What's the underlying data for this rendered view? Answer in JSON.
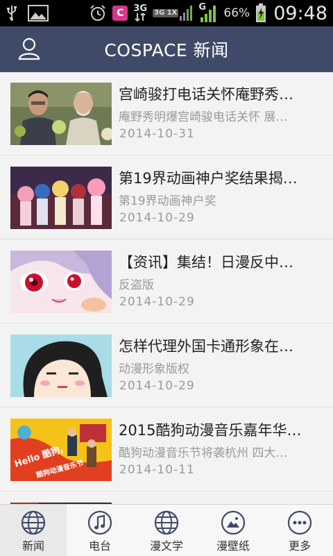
{
  "status_bar": {
    "network": "3G",
    "network_secondary": "3G 1X",
    "signal_label": "G",
    "battery": "66%",
    "time": "09:48",
    "badge_letter": "C"
  },
  "header": {
    "title": "COSPACE 新闻"
  },
  "news": [
    {
      "title": "宫崎骏打电话关怀庵野秀…",
      "summary": "庵野秀明爆宫崎骏电话关怀 展…",
      "date": "2014-10-31"
    },
    {
      "title": "第19界动画神户奖结果揭…",
      "summary": "第19界动画神户奖",
      "date": "2014-10-29"
    },
    {
      "title": "【资讯】集结！日漫反中…",
      "summary": "反盗版",
      "date": "2014-10-29"
    },
    {
      "title": "怎样代理外国卡通形象在…",
      "summary": "动漫形象版权",
      "date": "2014-10-29"
    },
    {
      "title": "2015酷狗动漫音乐嘉年华…",
      "summary": "酷狗动漫音乐节将袭杭州 四大…",
      "date": "2014-10-11"
    }
  ],
  "thumb5_text": {
    "hello": "Hello 酷狗,",
    "festival": "酷狗动漫音乐节"
  },
  "nav": [
    {
      "label": "新闻",
      "icon": "globe-icon"
    },
    {
      "label": "电台",
      "icon": "music-note-icon"
    },
    {
      "label": "漫文学",
      "icon": "globe-icon"
    },
    {
      "label": "漫壁纸",
      "icon": "image-icon"
    },
    {
      "label": "更多",
      "icon": "more-icon"
    }
  ],
  "colors": {
    "header_bg": "#3f4a68",
    "nav_icon": "#3f4a68",
    "text_dark": "#222222",
    "text_light": "#9a9a9a"
  }
}
